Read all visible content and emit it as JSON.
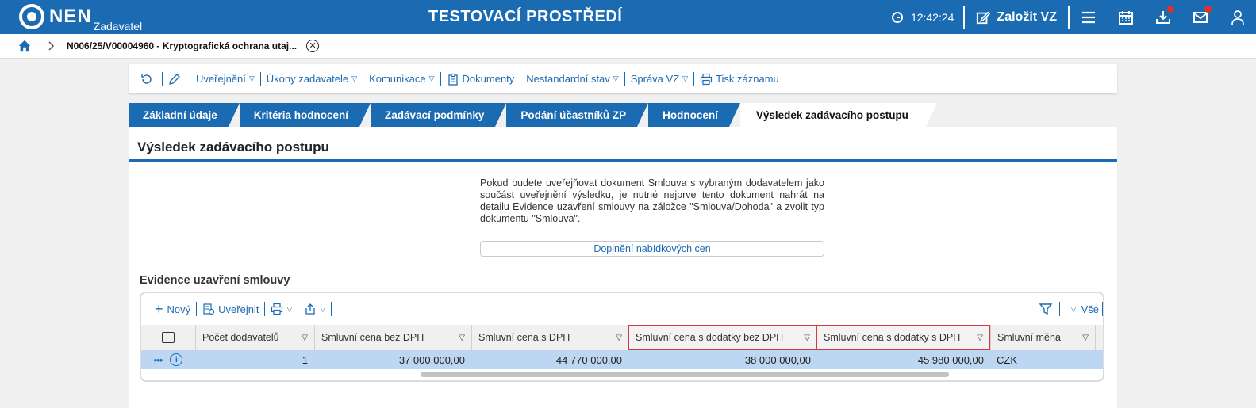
{
  "header": {
    "logo_text": "NEN",
    "logo_sub": "Zadavatel",
    "env_title": "TESTOVACÍ PROSTŘEDÍ",
    "clock": "12:42:24",
    "create_label": "Založit VZ"
  },
  "breadcrumb": {
    "current": "N006/25/V00004960 - Kryptografická ochrana utaj..."
  },
  "toolbar": {
    "items": [
      {
        "label": "Uveřejnění"
      },
      {
        "label": "Úkony zadavatele"
      },
      {
        "label": "Komunikace"
      },
      {
        "label": "Dokumenty"
      },
      {
        "label": "Nestandardní stav"
      },
      {
        "label": "Správa VZ"
      },
      {
        "label": "Tisk záznamu"
      }
    ]
  },
  "tabs": [
    {
      "label": "Základní údaje"
    },
    {
      "label": "Kritéria hodnocení"
    },
    {
      "label": "Zadávací podmínky"
    },
    {
      "label": "Podání účastníků ZP"
    },
    {
      "label": "Hodnocení"
    },
    {
      "label": "Výsledek zadávacího postupu",
      "active": true
    }
  ],
  "panel": {
    "title": "Výsledek zadávacího postupu",
    "info": "Pokud budete uveřejňovat dokument Smlouva s vybraným dodavatelem jako součást uveřejnění výsledku, je nutné nejprve tento dokument nahrát na detailu Evidence uzavření smlouvy na záložce \"Smlouva/Dohoda\" a zvolit typ dokumentu \"Smlouva\".",
    "fill_button": "Doplnění nabídkových cen",
    "section_title": "Evidence uzavření smlouvy"
  },
  "grid": {
    "toolbar": {
      "new": "Nový",
      "publish": "Uveřejnit",
      "all": "Vše"
    },
    "columns": [
      "Počet dodavatelů",
      "Smluvní cena bez DPH",
      "Smluvní cena s DPH",
      "Smluvní cena s dodatky bez DPH",
      "Smluvní cena s dodatky s DPH",
      "Smluvní měna"
    ],
    "row": {
      "count": "1",
      "price_no_vat": "37 000 000,00",
      "price_vat": "44 770 000,00",
      "price_amend_no_vat": "38 000 000,00",
      "price_amend_vat": "45 980 000,00",
      "currency": "CZK"
    }
  },
  "colors": {
    "brand": "#1b6bb3",
    "selected_row": "#bdd6f2",
    "highlight_border": "#d63a3a",
    "notification": "#e0302c"
  }
}
